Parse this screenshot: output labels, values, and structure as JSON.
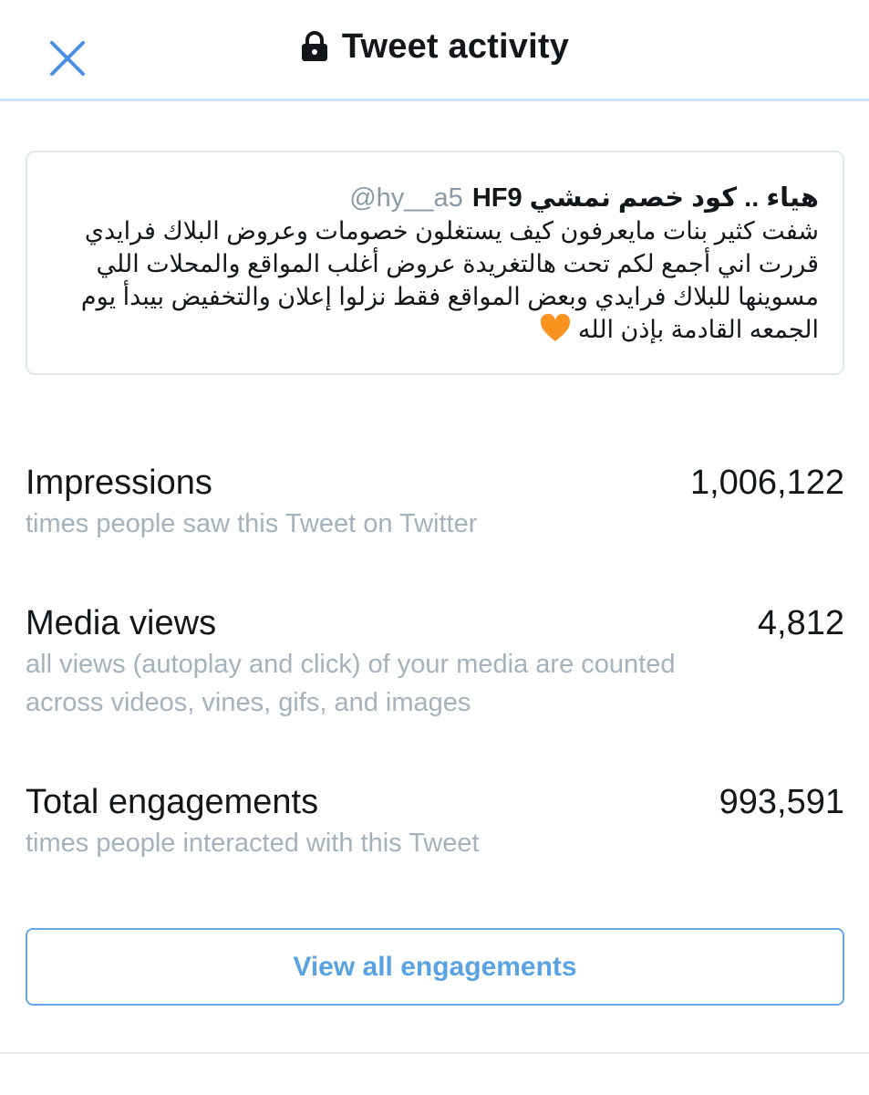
{
  "header": {
    "title": "Tweet activity",
    "close_icon": "close-icon",
    "lock_icon": "lock-icon",
    "accent_color": "#4a90e2"
  },
  "tweet": {
    "name": "هياء .. كود خصم نمشي HF9",
    "handle": "@hy__a5",
    "lines": [
      "شفت كثير بنات مايعرفون كيف يستغلون خصومات وعروض البلاك فرايدي",
      "قررت اني أجمع لكم تحت هالتغريدة عروض أغلب المواقع والمحلات اللي",
      "مسوينها للبلاك فرايدي وبعض المواقع فقط نزلوا إعلان والتخفيض بيبدأ يوم",
      "الجمعه القادمة بإذن الله"
    ],
    "emoji_icon": "orange-heart-icon"
  },
  "metrics": [
    {
      "label": "Impressions",
      "value": "1,006,122",
      "desc_lines": [
        "times people saw this Tweet on Twitter"
      ]
    },
    {
      "label": "Media views",
      "value": "4,812",
      "desc_lines": [
        "all views (autoplay and click) of your media are counted",
        "across videos, vines, gifs, and images"
      ]
    },
    {
      "label": "Total engagements",
      "value": "993,591",
      "desc_lines": [
        "times people interacted with this Tweet"
      ]
    }
  ],
  "actions": {
    "view_all_label": "View all engagements",
    "button_color": "#5aa3e2"
  }
}
